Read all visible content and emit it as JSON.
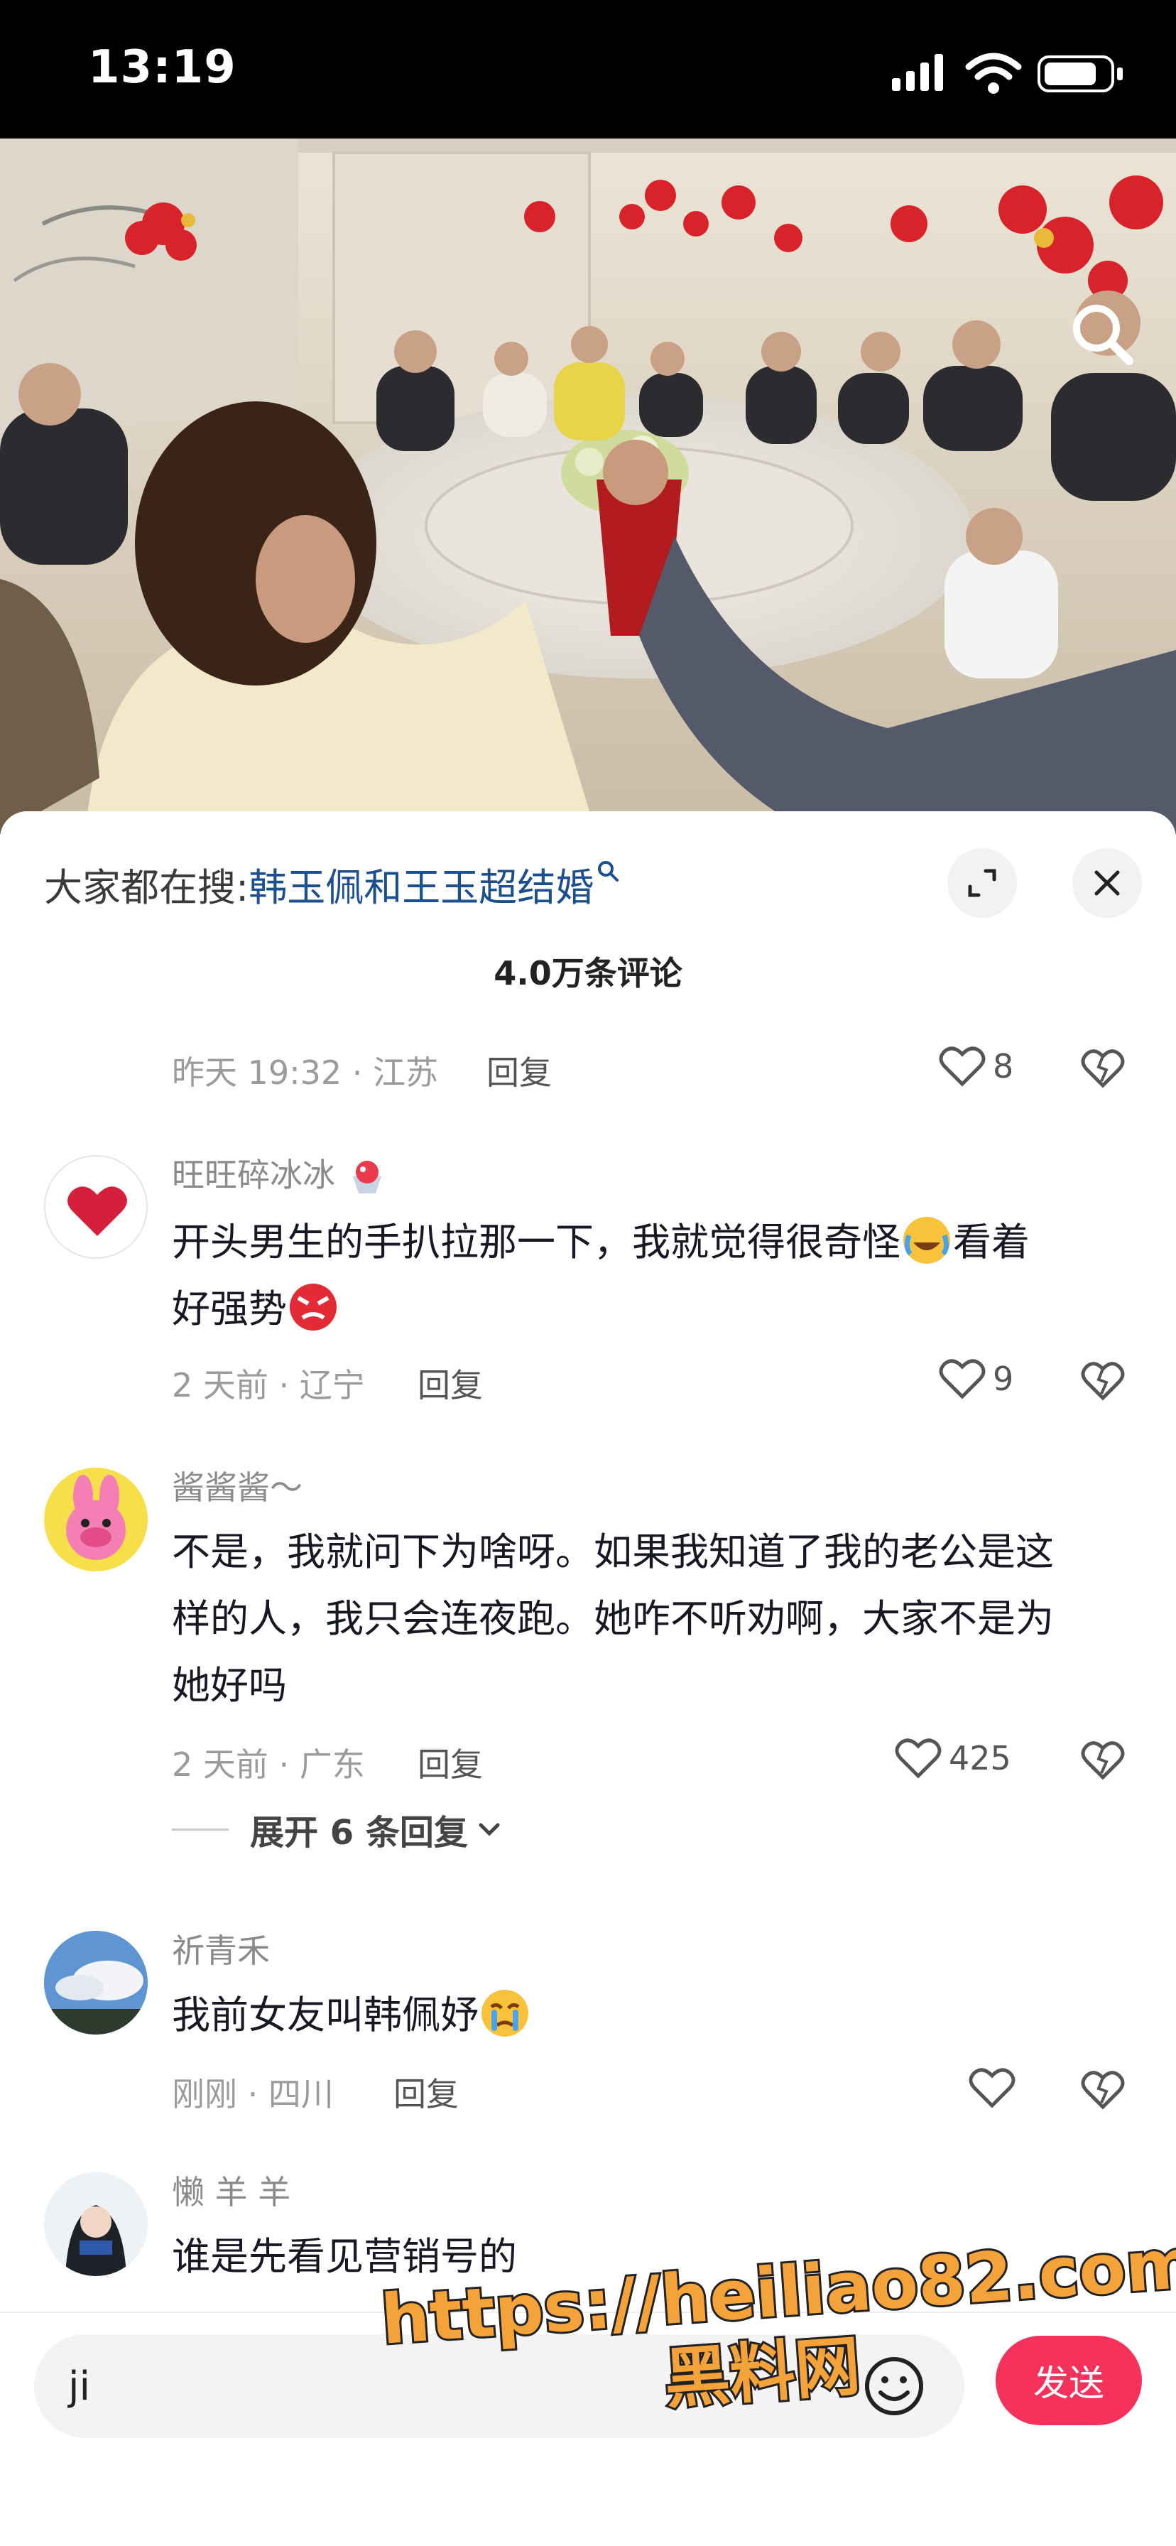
{
  "status_bar": {
    "time": "13:19"
  },
  "search_bar": {
    "prefix": "大家都在搜:",
    "term": "韩玉佩和王玉超结婚",
    "suffix_icon": "search-q-icon"
  },
  "comments_count": "4.0万条评论",
  "comments": [
    {
      "time_location": "昨天 19:32 · 江苏",
      "reply_label": "回复",
      "likes": "8"
    },
    {
      "username": "旺旺碎冰冰",
      "text_a": "开头男生的手扒拉那一下，我就觉得很奇怪",
      "text_b": "看着",
      "text_c": "好强势",
      "time_location": "2 天前 · 辽宁",
      "reply_label": "回复",
      "likes": "9"
    },
    {
      "username": "酱酱酱～",
      "text_line1": "不是，我就问下为啥呀。如果我知道了我的老公是这",
      "text_line2": "样的人，我只会连夜跑。她咋不听劝啊，大家不是为",
      "text_line3": "她好吗",
      "time_location": "2 天前 · 广东",
      "reply_label": "回复",
      "likes": "425",
      "expand_label": "展开 6 条回复"
    },
    {
      "username": "祈青禾",
      "text": "我前女友叫韩佩妤",
      "time_location": "刚刚 · 四川",
      "reply_label": "回复",
      "likes": ""
    },
    {
      "username": "懒 羊 羊",
      "text": "谁是先看见营销号的"
    }
  ],
  "input": {
    "value": "ji",
    "send_label": "发送"
  },
  "watermark": {
    "line1": "https://heiliao82.com",
    "line2": "黑料网"
  },
  "colors": {
    "accent": "#f5325c",
    "search_term": "#1b4f8f",
    "meta_gray": "#9b9b9b"
  }
}
